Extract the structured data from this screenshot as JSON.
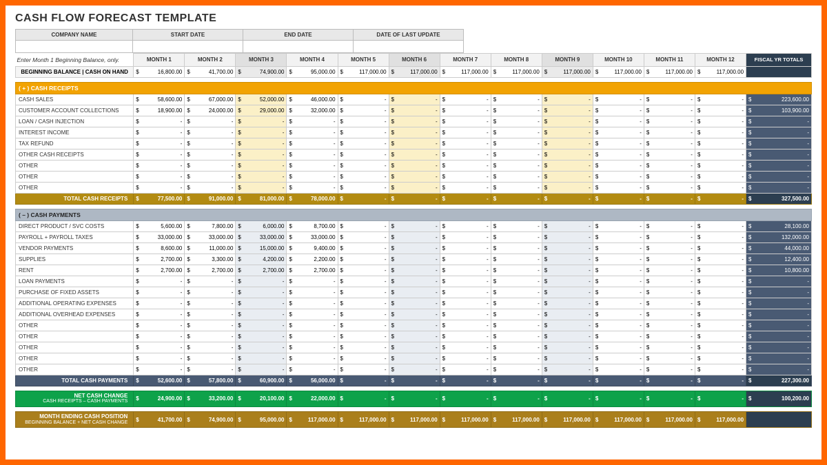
{
  "title": "CASH FLOW FORECAST TEMPLATE",
  "meta_labels": [
    "COMPANY NAME",
    "START DATE",
    "END DATE",
    "DATE OF LAST UPDATE"
  ],
  "instruction": "Enter Month 1 Beginning Balance, only.",
  "months": [
    "MONTH 1",
    "MONTH 2",
    "MONTH 3",
    "MONTH 4",
    "MONTH 5",
    "MONTH 6",
    "MONTH 7",
    "MONTH 8",
    "MONTH 9",
    "MONTH 10",
    "MONTH 11",
    "MONTH 12"
  ],
  "fy_label": "FISCAL YR TOTALS",
  "beginning_balance": {
    "label": "BEGINNING BALANCE | CASH ON HAND",
    "values": [
      "16,800.00",
      "41,700.00",
      "74,900.00",
      "95,000.00",
      "117,000.00",
      "117,000.00",
      "117,000.00",
      "117,000.00",
      "117,000.00",
      "117,000.00",
      "117,000.00",
      "117,000.00"
    ],
    "fy": ""
  },
  "receipts": {
    "header": "( + )  CASH RECEIPTS",
    "rows": [
      {
        "label": "CASH SALES",
        "values": [
          "58,600.00",
          "67,000.00",
          "52,000.00",
          "46,000.00",
          "-",
          "-",
          "-",
          "-",
          "-",
          "-",
          "-",
          "-"
        ],
        "fy": "223,600.00"
      },
      {
        "label": "CUSTOMER ACCOUNT COLLECTIONS",
        "values": [
          "18,900.00",
          "24,000.00",
          "29,000.00",
          "32,000.00",
          "-",
          "-",
          "-",
          "-",
          "-",
          "-",
          "-",
          "-"
        ],
        "fy": "103,900.00"
      },
      {
        "label": "LOAN / CASH INJECTION",
        "values": [
          "-",
          "-",
          "-",
          "-",
          "-",
          "-",
          "-",
          "-",
          "-",
          "-",
          "-",
          "-"
        ],
        "fy": "-"
      },
      {
        "label": "INTEREST INCOME",
        "values": [
          "-",
          "-",
          "-",
          "-",
          "-",
          "-",
          "-",
          "-",
          "-",
          "-",
          "-",
          "-"
        ],
        "fy": "-"
      },
      {
        "label": "TAX REFUND",
        "values": [
          "-",
          "-",
          "-",
          "-",
          "-",
          "-",
          "-",
          "-",
          "-",
          "-",
          "-",
          "-"
        ],
        "fy": "-"
      },
      {
        "label": "OTHER CASH RECEIPTS",
        "values": [
          "-",
          "-",
          "-",
          "-",
          "-",
          "-",
          "-",
          "-",
          "-",
          "-",
          "-",
          "-"
        ],
        "fy": "-"
      },
      {
        "label": "OTHER",
        "values": [
          "-",
          "-",
          "-",
          "-",
          "-",
          "-",
          "-",
          "-",
          "-",
          "-",
          "-",
          "-"
        ],
        "fy": "-"
      },
      {
        "label": "OTHER",
        "values": [
          "-",
          "-",
          "-",
          "-",
          "-",
          "-",
          "-",
          "-",
          "-",
          "-",
          "-",
          "-"
        ],
        "fy": "-"
      },
      {
        "label": "OTHER",
        "values": [
          "-",
          "-",
          "-",
          "-",
          "-",
          "-",
          "-",
          "-",
          "-",
          "-",
          "-",
          "-"
        ],
        "fy": "-"
      }
    ],
    "total": {
      "label": "TOTAL CASH RECEIPTS",
      "values": [
        "77,500.00",
        "91,000.00",
        "81,000.00",
        "78,000.00",
        "-",
        "-",
        "-",
        "-",
        "-",
        "-",
        "-",
        "-"
      ],
      "fy": "327,500.00"
    }
  },
  "payments": {
    "header": "( – )  CASH PAYMENTS",
    "rows": [
      {
        "label": "DIRECT PRODUCT / SVC COSTS",
        "values": [
          "5,600.00",
          "7,800.00",
          "6,000.00",
          "8,700.00",
          "-",
          "-",
          "-",
          "-",
          "-",
          "-",
          "-",
          "-"
        ],
        "fy": "28,100.00"
      },
      {
        "label": "PAYROLL + PAYROLL TAXES",
        "values": [
          "33,000.00",
          "33,000.00",
          "33,000.00",
          "33,000.00",
          "-",
          "-",
          "-",
          "-",
          "-",
          "-",
          "-",
          "-"
        ],
        "fy": "132,000.00"
      },
      {
        "label": "VENDOR PAYMENTS",
        "values": [
          "8,600.00",
          "11,000.00",
          "15,000.00",
          "9,400.00",
          "-",
          "-",
          "-",
          "-",
          "-",
          "-",
          "-",
          "-"
        ],
        "fy": "44,000.00"
      },
      {
        "label": "SUPPLIES",
        "values": [
          "2,700.00",
          "3,300.00",
          "4,200.00",
          "2,200.00",
          "-",
          "-",
          "-",
          "-",
          "-",
          "-",
          "-",
          "-"
        ],
        "fy": "12,400.00"
      },
      {
        "label": "RENT",
        "values": [
          "2,700.00",
          "2,700.00",
          "2,700.00",
          "2,700.00",
          "-",
          "-",
          "-",
          "-",
          "-",
          "-",
          "-",
          "-"
        ],
        "fy": "10,800.00"
      },
      {
        "label": "LOAN PAYMENTS",
        "values": [
          "-",
          "-",
          "-",
          "-",
          "-",
          "-",
          "-",
          "-",
          "-",
          "-",
          "-",
          "-"
        ],
        "fy": "-"
      },
      {
        "label": "PURCHASE OF FIXED ASSETS",
        "values": [
          "-",
          "-",
          "-",
          "-",
          "-",
          "-",
          "-",
          "-",
          "-",
          "-",
          "-",
          "-"
        ],
        "fy": "-"
      },
      {
        "label": "ADDITIONAL OPERATING EXPENSES",
        "values": [
          "-",
          "-",
          "-",
          "-",
          "-",
          "-",
          "-",
          "-",
          "-",
          "-",
          "-",
          "-"
        ],
        "fy": "-"
      },
      {
        "label": "ADDITIONAL OVERHEAD EXPENSES",
        "values": [
          "-",
          "-",
          "-",
          "-",
          "-",
          "-",
          "-",
          "-",
          "-",
          "-",
          "-",
          "-"
        ],
        "fy": "-"
      },
      {
        "label": "OTHER",
        "values": [
          "-",
          "-",
          "-",
          "-",
          "-",
          "-",
          "-",
          "-",
          "-",
          "-",
          "-",
          "-"
        ],
        "fy": "-"
      },
      {
        "label": "OTHER",
        "values": [
          "-",
          "-",
          "-",
          "-",
          "-",
          "-",
          "-",
          "-",
          "-",
          "-",
          "-",
          "-"
        ],
        "fy": "-"
      },
      {
        "label": "OTHER",
        "values": [
          "-",
          "-",
          "-",
          "-",
          "-",
          "-",
          "-",
          "-",
          "-",
          "-",
          "-",
          "-"
        ],
        "fy": "-"
      },
      {
        "label": "OTHER",
        "values": [
          "-",
          "-",
          "-",
          "-",
          "-",
          "-",
          "-",
          "-",
          "-",
          "-",
          "-",
          "-"
        ],
        "fy": "-"
      },
      {
        "label": "OTHER",
        "values": [
          "-",
          "-",
          "-",
          "-",
          "-",
          "-",
          "-",
          "-",
          "-",
          "-",
          "-",
          "-"
        ],
        "fy": "-"
      }
    ],
    "total": {
      "label": "TOTAL CASH PAYMENTS",
      "values": [
        "52,600.00",
        "57,800.00",
        "60,900.00",
        "56,000.00",
        "-",
        "-",
        "-",
        "-",
        "-",
        "-",
        "-",
        "-"
      ],
      "fy": "227,300.00"
    }
  },
  "net_change": {
    "label": "NET CASH CHANGE",
    "sub": "CASH RECEIPTS – CASH PAYMENTS",
    "values": [
      "24,900.00",
      "33,200.00",
      "20,100.00",
      "22,000.00",
      "-",
      "-",
      "-",
      "-",
      "-",
      "-",
      "-",
      "-"
    ],
    "fy": "100,200.00"
  },
  "ending_position": {
    "label": "MONTH ENDING CASH POSITION",
    "sub": "BEGINNING BALANCE + NET CASH CHANGE",
    "values": [
      "41,700.00",
      "74,900.00",
      "95,000.00",
      "117,000.00",
      "117,000.00",
      "117,000.00",
      "117,000.00",
      "117,000.00",
      "117,000.00",
      "117,000.00",
      "117,000.00",
      "117,000.00"
    ],
    "fy": ""
  }
}
